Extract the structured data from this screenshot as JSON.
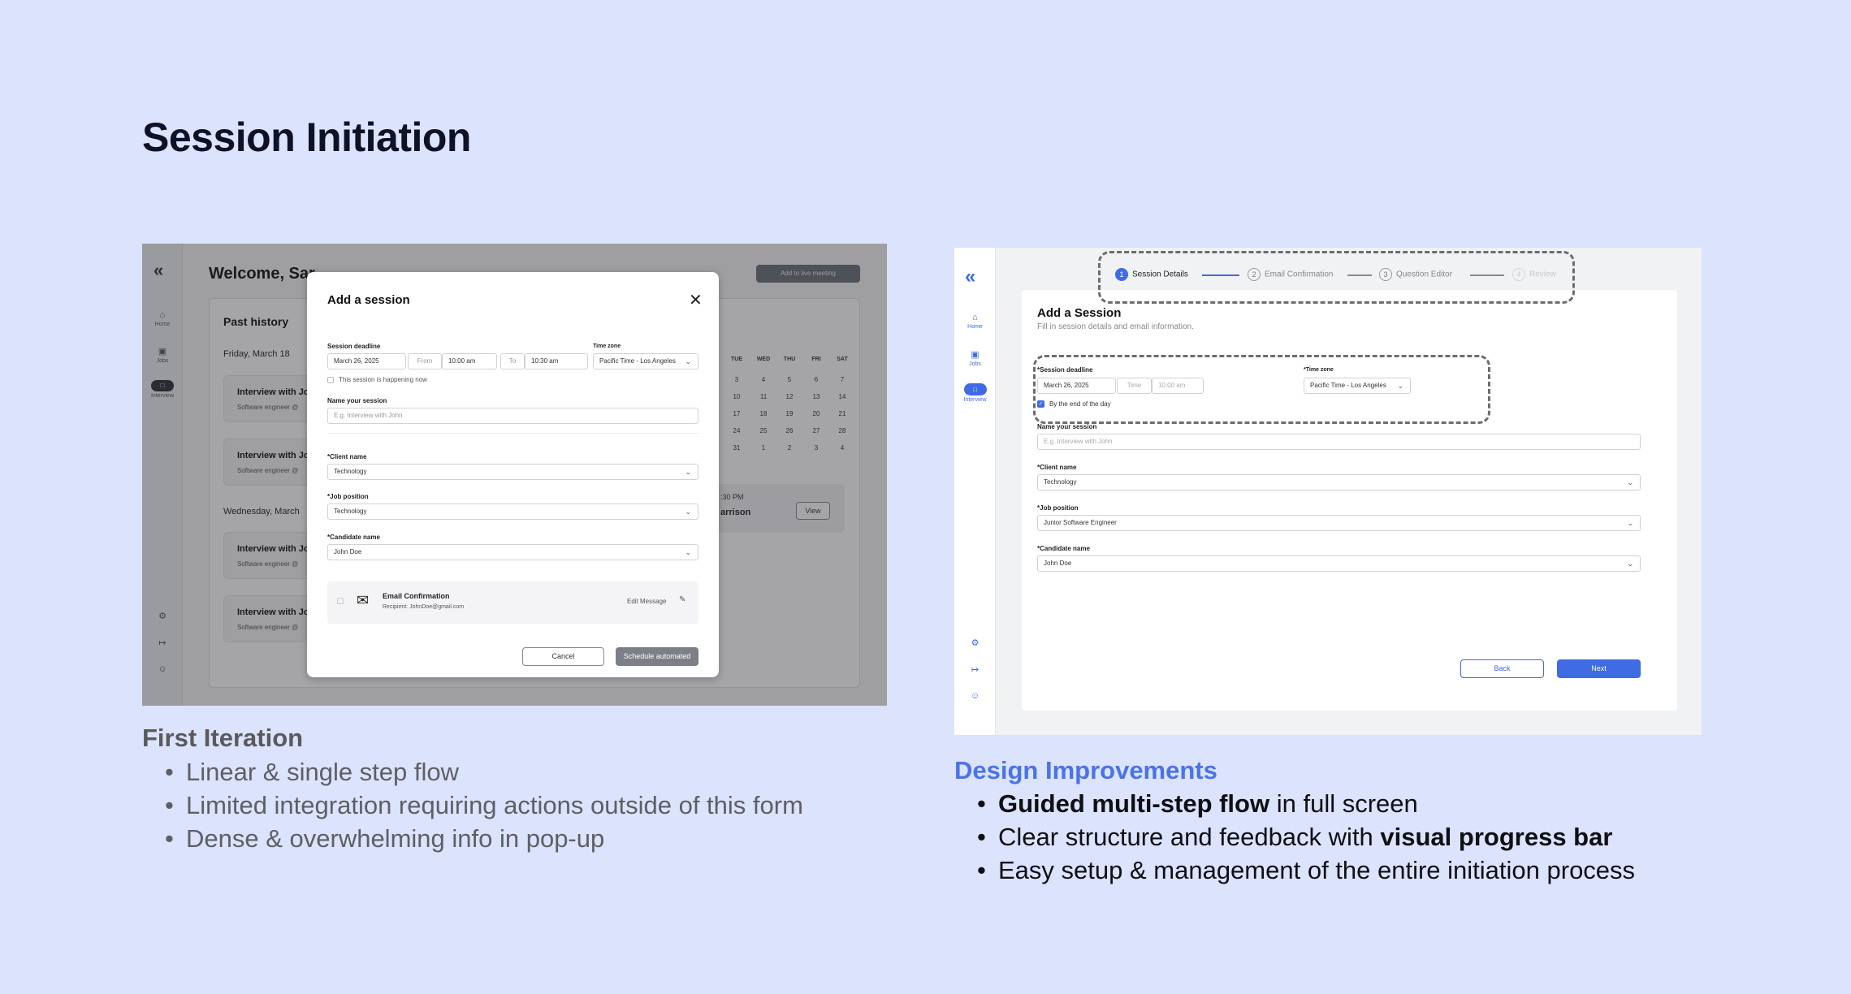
{
  "page": {
    "title": "Session Initiation"
  },
  "colors": {
    "background": "#dbe3fd",
    "accent": "#3f6be3",
    "caption_heading_blue": "#4a74e6"
  },
  "first": {
    "logo": "«",
    "nav": {
      "home": "Home",
      "jobs": "Jobs",
      "interview": "Interview"
    },
    "welcome": "Welcome, Sar",
    "live_button": "Add to live meeting",
    "past_history": "Past history",
    "day1": "Friday, March 18",
    "day2": "Wednesday, March",
    "cards": [
      {
        "title": "Interview with Jo",
        "sub": "Software engineer @"
      },
      {
        "title": "Interview with Jo",
        "sub": "Software engineer @"
      },
      {
        "title": "Interview with Jo",
        "sub": "Software engineer @"
      },
      {
        "title": "Interview with Jo",
        "sub": "Software engineer @"
      }
    ],
    "calendar": {
      "heads": [
        "TUE",
        "WED",
        "THU",
        "FRI",
        "SAT"
      ],
      "rows": [
        [
          "3",
          "4",
          "5",
          "6",
          "7"
        ],
        [
          "10",
          "11",
          "12",
          "13",
          "14"
        ],
        [
          "17",
          "18",
          "19",
          "20",
          "21"
        ],
        [
          "24",
          "25",
          "26",
          "27",
          "28"
        ],
        [
          "31",
          "1",
          "2",
          "3",
          "4"
        ]
      ]
    },
    "detail_time": ":30 PM",
    "detail_name": "arrison",
    "view_button": "View",
    "modal": {
      "title": "Add a session",
      "close": "✕",
      "deadline_label": "Session deadline",
      "deadline_value": "March 26, 2025",
      "from": "From",
      "from_value": "10:00 am",
      "to": "To",
      "to_value": "10:30 am",
      "tz_label": "Time zone",
      "tz_value": "Pacific Time - Los Angeles",
      "now_check": "This session is happening now",
      "name_label": "Name your session",
      "name_placeholder": "E.g. Interview with John",
      "client_label": "*Client name",
      "client_value": "Technology",
      "job_label": "*Job position",
      "job_value": "Technology",
      "cand_label": "*Candidate name",
      "cand_value": "John Doe",
      "email_title": "Email Confirmation",
      "email_recipient": "Recipient: JohnDoe@gmail.com",
      "edit_message": "Edit Message",
      "cancel": "Cancel",
      "schedule": "Schedule automated"
    }
  },
  "first_caption": {
    "heading": "First Iteration",
    "items": [
      "Linear & single step flow",
      "Limited integration requiring actions outside of this form",
      "Dense & overwhelming info in pop-up"
    ]
  },
  "second": {
    "logo": "«",
    "nav": {
      "home": "Home",
      "jobs": "Jobs",
      "interview": "Interview"
    },
    "steps": [
      {
        "num": "1",
        "label": "Session Details"
      },
      {
        "num": "2",
        "label": "Email Confirmation"
      },
      {
        "num": "3",
        "label": "Question Editor"
      },
      {
        "num": "4",
        "label": "Review"
      }
    ],
    "title": "Add a Session",
    "subtitle": "Fill in session details and email information.",
    "deadline_label": "*Session deadline",
    "deadline_value": "March 26, 2025",
    "time_placeholder": "Time",
    "time_value": "10:00 am",
    "tz_label": "*Time zone",
    "tz_value": "Pacific Time - Los Angeles",
    "eod_check": "By the end of the day",
    "name_label": "Name your session",
    "name_placeholder": "E.g. Interview with John",
    "client_label": "*Client name",
    "client_value": "Technology",
    "job_label": "*Job position",
    "job_value": "Junior Software Engineer",
    "cand_label": "*Candidate name",
    "cand_value": "John Doe",
    "back": "Back",
    "next": "Next"
  },
  "second_caption": {
    "heading": "Design Improvements",
    "item1_bold": "Guided multi-step flow",
    "item1_rest": " in full screen",
    "item2_pre": "Clear structure and feedback with ",
    "item2_bold": "visual progress bar",
    "item3": "Easy setup & management of the entire initiation process"
  }
}
